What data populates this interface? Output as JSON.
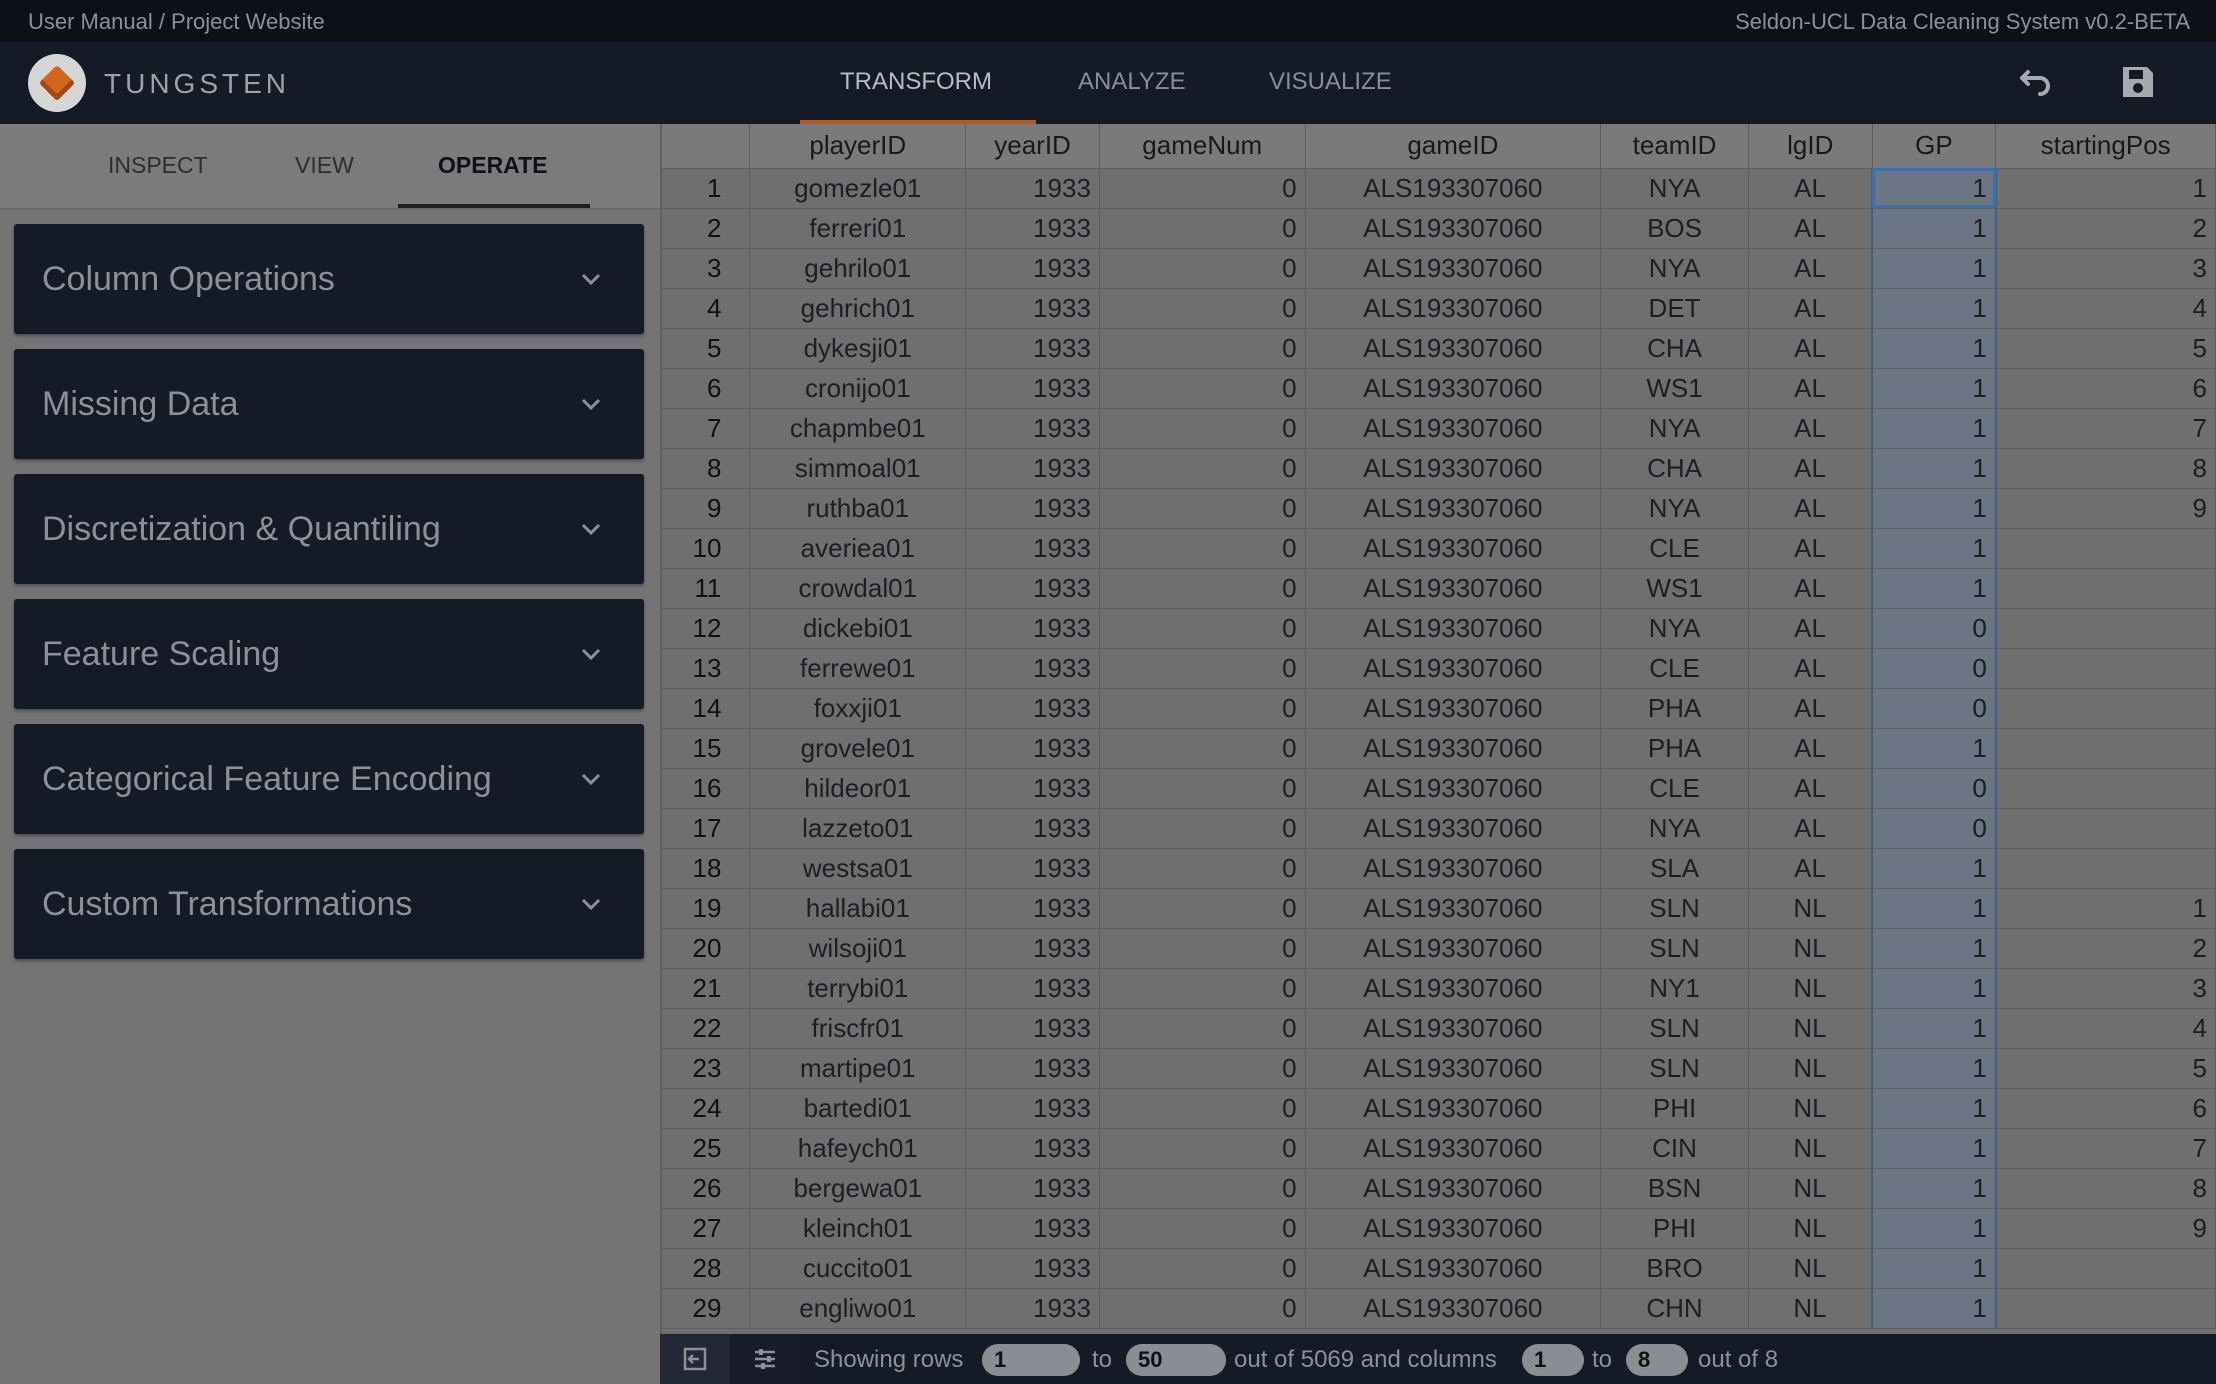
{
  "topbar": {
    "links": "User Manual / Project Website",
    "version": "Seldon-UCL Data Cleaning System v0.2-BETA"
  },
  "header": {
    "brand": "TUNGSTEN",
    "tabs": [
      {
        "label": "TRANSFORM",
        "active": true
      },
      {
        "label": "ANALYZE",
        "active": false
      },
      {
        "label": "VISUALIZE",
        "active": false
      }
    ],
    "icons": [
      "undo-icon",
      "save-icon"
    ]
  },
  "left": {
    "subtabs": [
      {
        "label": "INSPECT",
        "active": false
      },
      {
        "label": "VIEW",
        "active": false
      },
      {
        "label": "OPERATE",
        "active": true
      }
    ],
    "accordions": [
      "Column Operations",
      "Missing Data",
      "Discretization & Quantiling",
      "Feature Scaling",
      "Categorical Feature Encoding",
      "Custom Transformations"
    ]
  },
  "grid": {
    "columns": [
      "playerID",
      "yearID",
      "gameNum",
      "gameID",
      "teamID",
      "lgID",
      "GP",
      "startingPos"
    ],
    "selected_cell": {
      "row": 1,
      "column": "GP"
    },
    "rows": [
      [
        "1",
        "gomezle01",
        "1933",
        "0",
        "ALS193307060",
        "NYA",
        "AL",
        "1",
        "1"
      ],
      [
        "2",
        "ferreri01",
        "1933",
        "0",
        "ALS193307060",
        "BOS",
        "AL",
        "1",
        "2"
      ],
      [
        "3",
        "gehrilo01",
        "1933",
        "0",
        "ALS193307060",
        "NYA",
        "AL",
        "1",
        "3"
      ],
      [
        "4",
        "gehrich01",
        "1933",
        "0",
        "ALS193307060",
        "DET",
        "AL",
        "1",
        "4"
      ],
      [
        "5",
        "dykesji01",
        "1933",
        "0",
        "ALS193307060",
        "CHA",
        "AL",
        "1",
        "5"
      ],
      [
        "6",
        "cronijo01",
        "1933",
        "0",
        "ALS193307060",
        "WS1",
        "AL",
        "1",
        "6"
      ],
      [
        "7",
        "chapmbe01",
        "1933",
        "0",
        "ALS193307060",
        "NYA",
        "AL",
        "1",
        "7"
      ],
      [
        "8",
        "simmoal01",
        "1933",
        "0",
        "ALS193307060",
        "CHA",
        "AL",
        "1",
        "8"
      ],
      [
        "9",
        "ruthba01",
        "1933",
        "0",
        "ALS193307060",
        "NYA",
        "AL",
        "1",
        "9"
      ],
      [
        "10",
        "averiea01",
        "1933",
        "0",
        "ALS193307060",
        "CLE",
        "AL",
        "1",
        ""
      ],
      [
        "11",
        "crowdal01",
        "1933",
        "0",
        "ALS193307060",
        "WS1",
        "AL",
        "1",
        ""
      ],
      [
        "12",
        "dickebi01",
        "1933",
        "0",
        "ALS193307060",
        "NYA",
        "AL",
        "0",
        ""
      ],
      [
        "13",
        "ferrewe01",
        "1933",
        "0",
        "ALS193307060",
        "CLE",
        "AL",
        "0",
        ""
      ],
      [
        "14",
        "foxxji01",
        "1933",
        "0",
        "ALS193307060",
        "PHA",
        "AL",
        "0",
        ""
      ],
      [
        "15",
        "grovele01",
        "1933",
        "0",
        "ALS193307060",
        "PHA",
        "AL",
        "1",
        ""
      ],
      [
        "16",
        "hildeor01",
        "1933",
        "0",
        "ALS193307060",
        "CLE",
        "AL",
        "0",
        ""
      ],
      [
        "17",
        "lazzeto01",
        "1933",
        "0",
        "ALS193307060",
        "NYA",
        "AL",
        "0",
        ""
      ],
      [
        "18",
        "westsa01",
        "1933",
        "0",
        "ALS193307060",
        "SLA",
        "AL",
        "1",
        ""
      ],
      [
        "19",
        "hallabi01",
        "1933",
        "0",
        "ALS193307060",
        "SLN",
        "NL",
        "1",
        "1"
      ],
      [
        "20",
        "wilsoji01",
        "1933",
        "0",
        "ALS193307060",
        "SLN",
        "NL",
        "1",
        "2"
      ],
      [
        "21",
        "terrybi01",
        "1933",
        "0",
        "ALS193307060",
        "NY1",
        "NL",
        "1",
        "3"
      ],
      [
        "22",
        "friscfr01",
        "1933",
        "0",
        "ALS193307060",
        "SLN",
        "NL",
        "1",
        "4"
      ],
      [
        "23",
        "martipe01",
        "1933",
        "0",
        "ALS193307060",
        "SLN",
        "NL",
        "1",
        "5"
      ],
      [
        "24",
        "bartedi01",
        "1933",
        "0",
        "ALS193307060",
        "PHI",
        "NL",
        "1",
        "6"
      ],
      [
        "25",
        "hafeych01",
        "1933",
        "0",
        "ALS193307060",
        "CIN",
        "NL",
        "1",
        "7"
      ],
      [
        "26",
        "bergewa01",
        "1933",
        "0",
        "ALS193307060",
        "BSN",
        "NL",
        "1",
        "8"
      ],
      [
        "27",
        "kleinch01",
        "1933",
        "0",
        "ALS193307060",
        "PHI",
        "NL",
        "1",
        "9"
      ],
      [
        "28",
        "cuccito01",
        "1933",
        "0",
        "ALS193307060",
        "BRO",
        "NL",
        "1",
        ""
      ],
      [
        "29",
        "engliwo01",
        "1933",
        "0",
        "ALS193307060",
        "CHN",
        "NL",
        "1",
        ""
      ]
    ]
  },
  "footer": {
    "showing_rows": "Showing rows",
    "to": "to",
    "rows_from": "1",
    "rows_to": "50",
    "rows_total_text": "out of 5069 and columns",
    "cols_from": "1",
    "cols_to": "8",
    "cols_total_text": "out of 8"
  }
}
